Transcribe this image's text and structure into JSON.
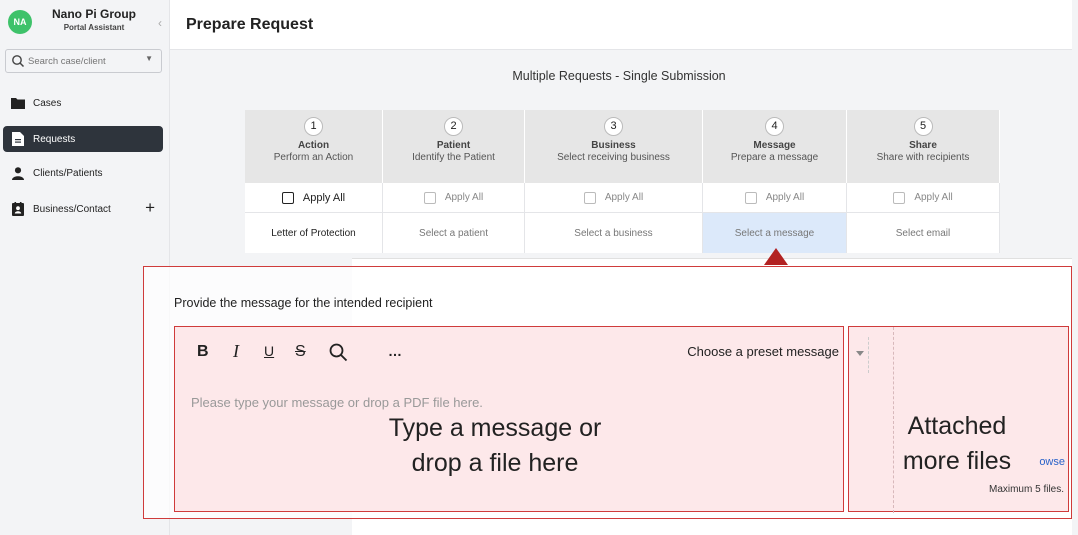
{
  "sidebar": {
    "avatar": "NA",
    "brand_name": "Nano Pi Group",
    "brand_sub": "Portal Assistant",
    "collapse_icon": "chevron-left-icon",
    "search_placeholder": "Search case/client",
    "items": [
      {
        "label": "Cases",
        "icon": "folder-icon",
        "active": false
      },
      {
        "label": "Requests",
        "icon": "document-icon",
        "active": true
      },
      {
        "label": "Clients/Patients",
        "icon": "person-icon",
        "active": false
      },
      {
        "label": "Business/Contact",
        "icon": "contact-book-icon",
        "active": false
      }
    ]
  },
  "header": {
    "title": "Prepare Request"
  },
  "main": {
    "subtitle": "Multiple Requests - Single Submission",
    "steps": [
      {
        "num": "1",
        "title": "Action",
        "desc": "Perform an Action",
        "apply": "Apply All",
        "value": "Letter of Protection"
      },
      {
        "num": "2",
        "title": "Patient",
        "desc": "Identify the Patient",
        "apply": "Apply All",
        "value": "Select a patient"
      },
      {
        "num": "3",
        "title": "Business",
        "desc": "Select receiving business",
        "apply": "Apply All",
        "value": "Select a business"
      },
      {
        "num": "4",
        "title": "Message",
        "desc": "Prepare a message",
        "apply": "Apply All",
        "value": "Select a message"
      },
      {
        "num": "5",
        "title": "Share",
        "desc": "Share with recipients",
        "apply": "Apply All",
        "value": "Select email"
      }
    ],
    "message_panel": {
      "prompt": "Provide the message for the intended recipient",
      "toolbar": {
        "bold": "B",
        "italic": "I",
        "underline": "U",
        "strike": "S",
        "more": "…​"
      },
      "preset_label": "Choose a preset message",
      "editor_placeholder": "Please type your message or drop a PDF file here.",
      "dropzone_label_1": "Type a message or",
      "dropzone_label_2": "drop a file here",
      "attach_label_1": "Attached",
      "attach_label_2": "more files",
      "browse_link": "owse",
      "max_files": "Maximum 5 files."
    }
  },
  "colors": {
    "accent_dark": "#2e343c",
    "avatar_green": "#3ec26a",
    "highlight_blue": "#dce9fa",
    "annotation_red": "#cf3b3b"
  }
}
